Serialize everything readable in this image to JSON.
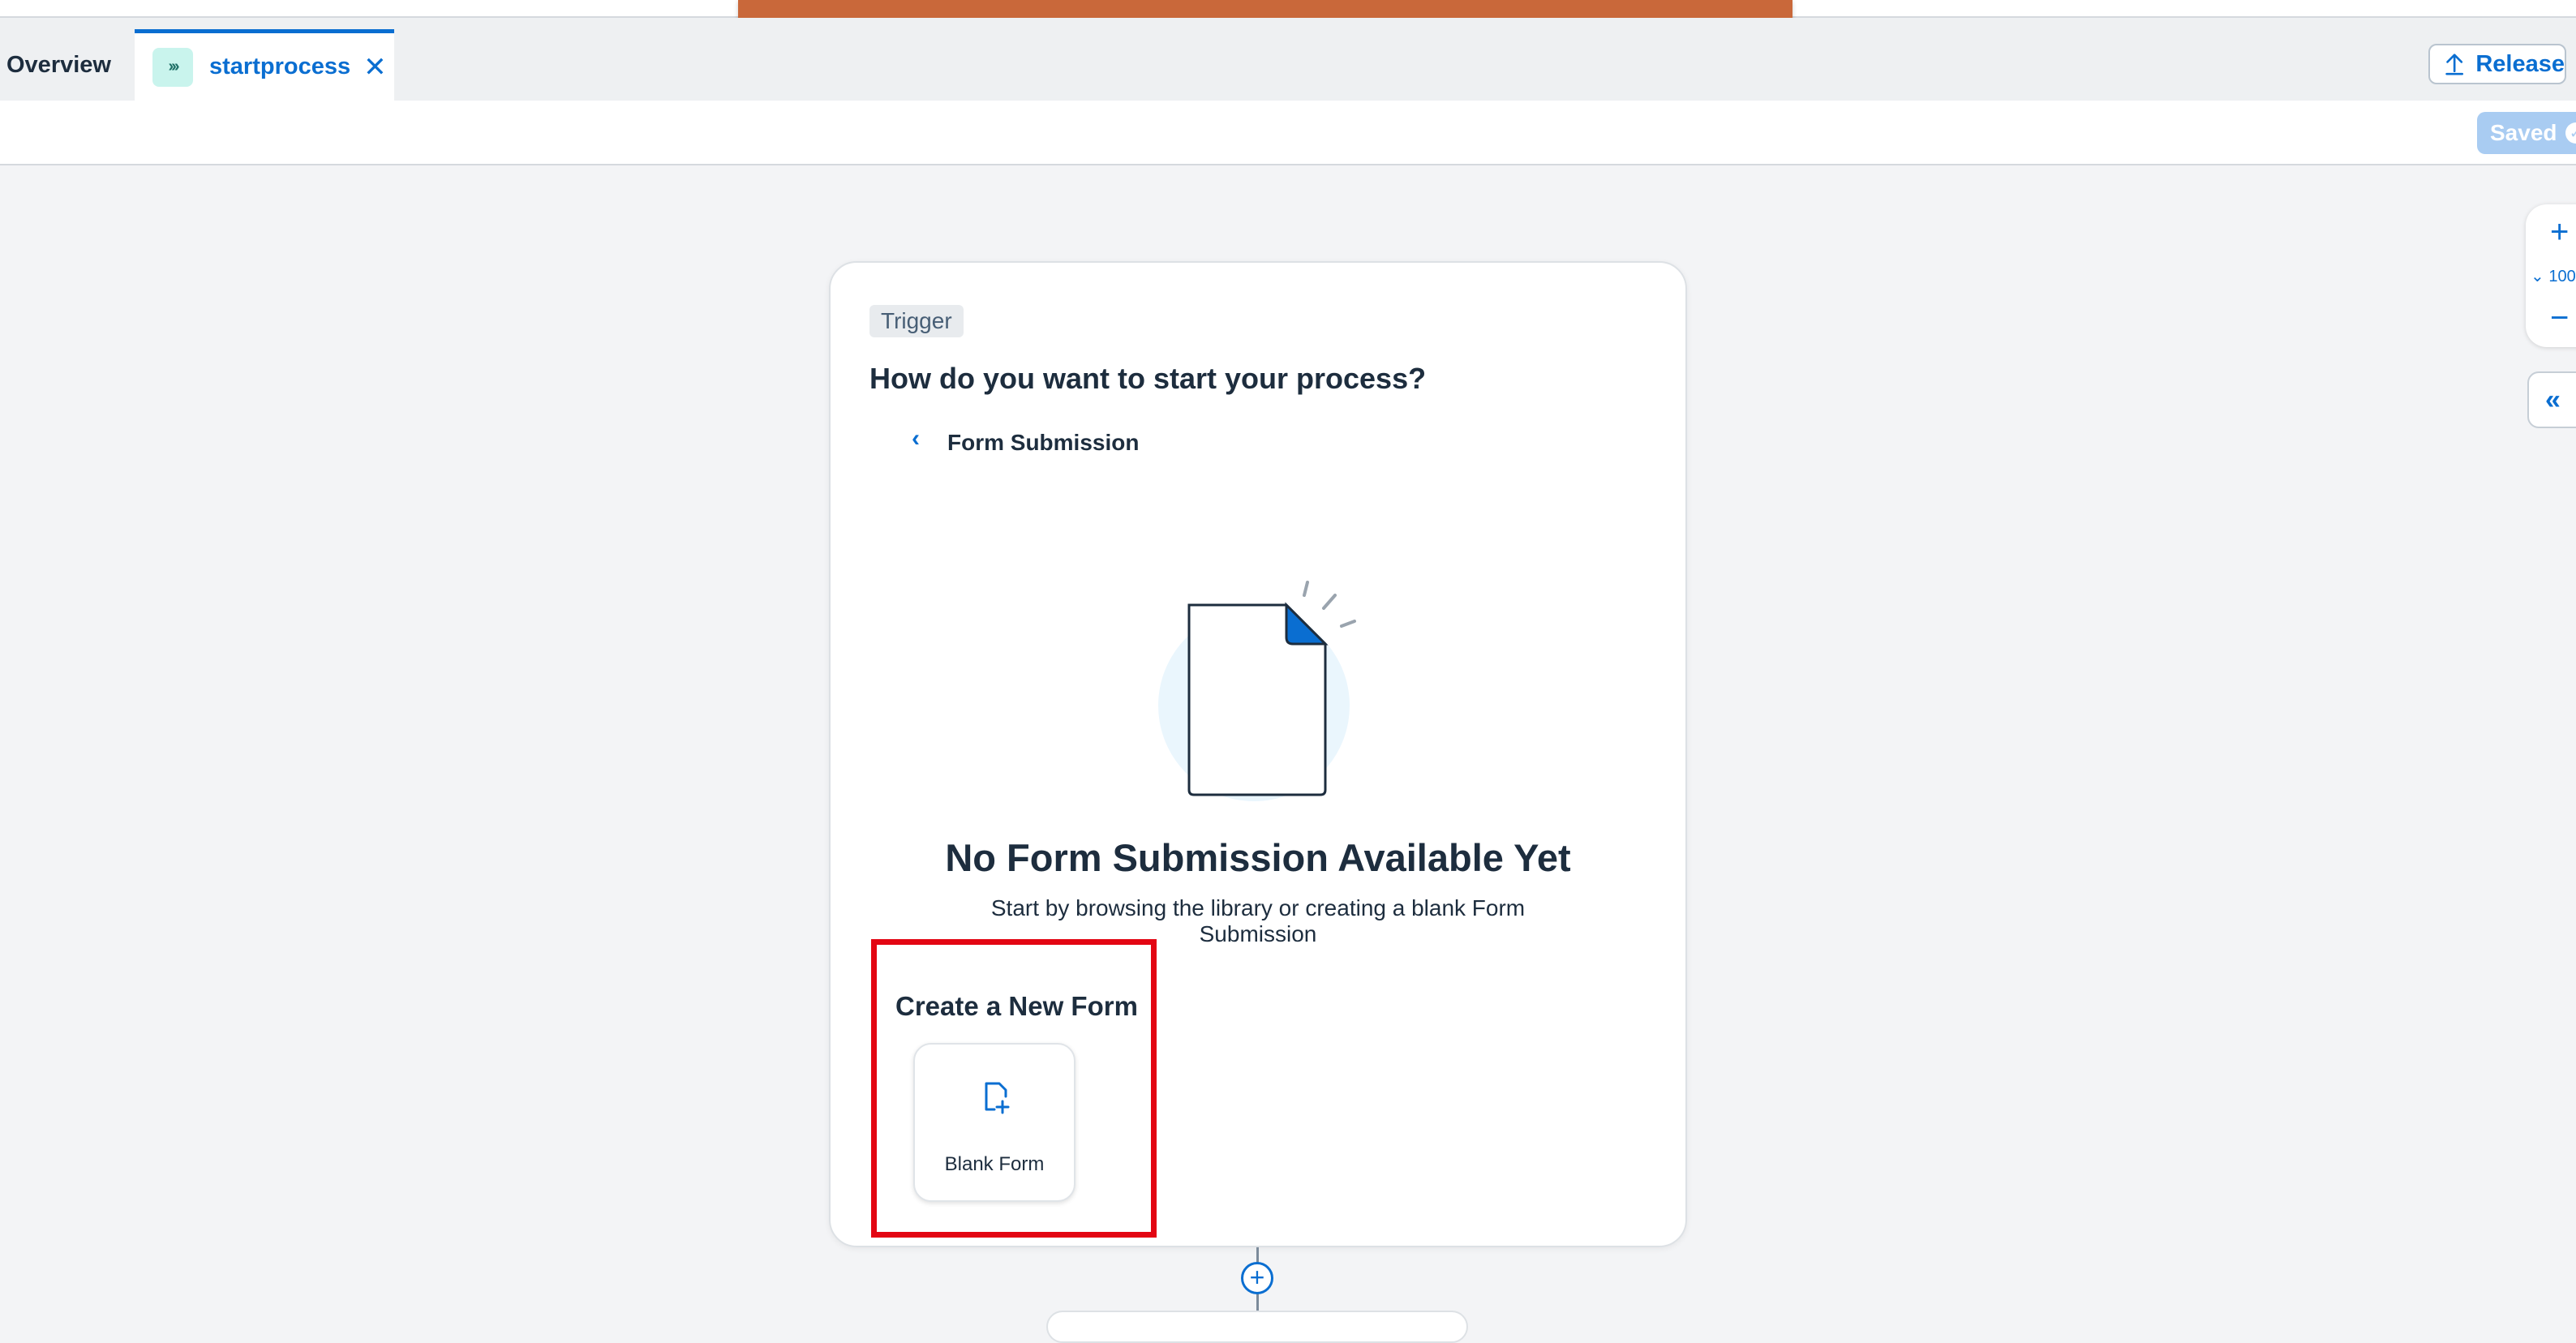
{
  "tabs": {
    "overview_label": "Overview",
    "active_label": "startprocess",
    "active_icon": "double-chevron-right-icon"
  },
  "header": {
    "release_label": "Release",
    "saved_label": "Saved"
  },
  "zoom": {
    "value_text": "100"
  },
  "trigger_card": {
    "badge": "Trigger",
    "title": "How do you want to start your process?",
    "subtitle": "Form Submission",
    "empty_title": "No Form Submission Available Yet",
    "empty_description": "Start by browsing the library or creating a blank Form Submission",
    "create_section_title": "Create a New Form",
    "blank_form_label": "Blank Form"
  },
  "colors": {
    "accent": "#0a6ed1",
    "toast": "#c9683a",
    "highlight": "#e30613",
    "tab_icon_bg": "#c9f4ed"
  }
}
